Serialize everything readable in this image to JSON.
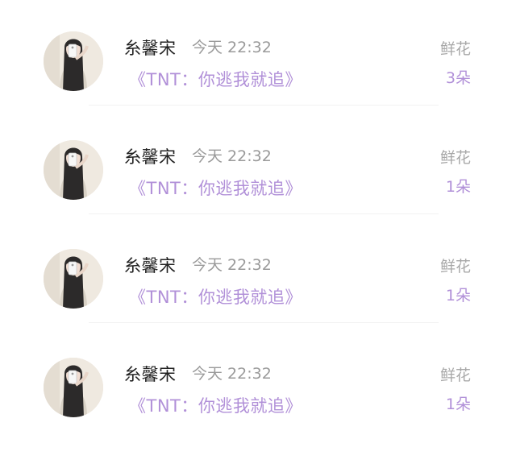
{
  "records": [
    {
      "user_name": "糸馨宋",
      "time": "今天 22:32",
      "book_title": "《TNT：你逃我就追》",
      "gift_type": "鲜花",
      "gift_count": "3朵"
    },
    {
      "user_name": "糸馨宋",
      "time": "今天 22:32",
      "book_title": "《TNT：你逃我就追》",
      "gift_type": "鲜花",
      "gift_count": "1朵"
    },
    {
      "user_name": "糸馨宋",
      "time": "今天 22:32",
      "book_title": "《TNT：你逃我就追》",
      "gift_type": "鲜花",
      "gift_count": "1朵"
    },
    {
      "user_name": "糸馨宋",
      "time": "今天 22:32",
      "book_title": "《TNT：你逃我就追》",
      "gift_type": "鲜花",
      "gift_count": "1朵"
    }
  ],
  "colors": {
    "accent_purple": "#b190d8",
    "name_text": "#222222",
    "muted_text": "#9a9a9a"
  },
  "icons": {
    "avatar": "user-avatar-photo"
  }
}
